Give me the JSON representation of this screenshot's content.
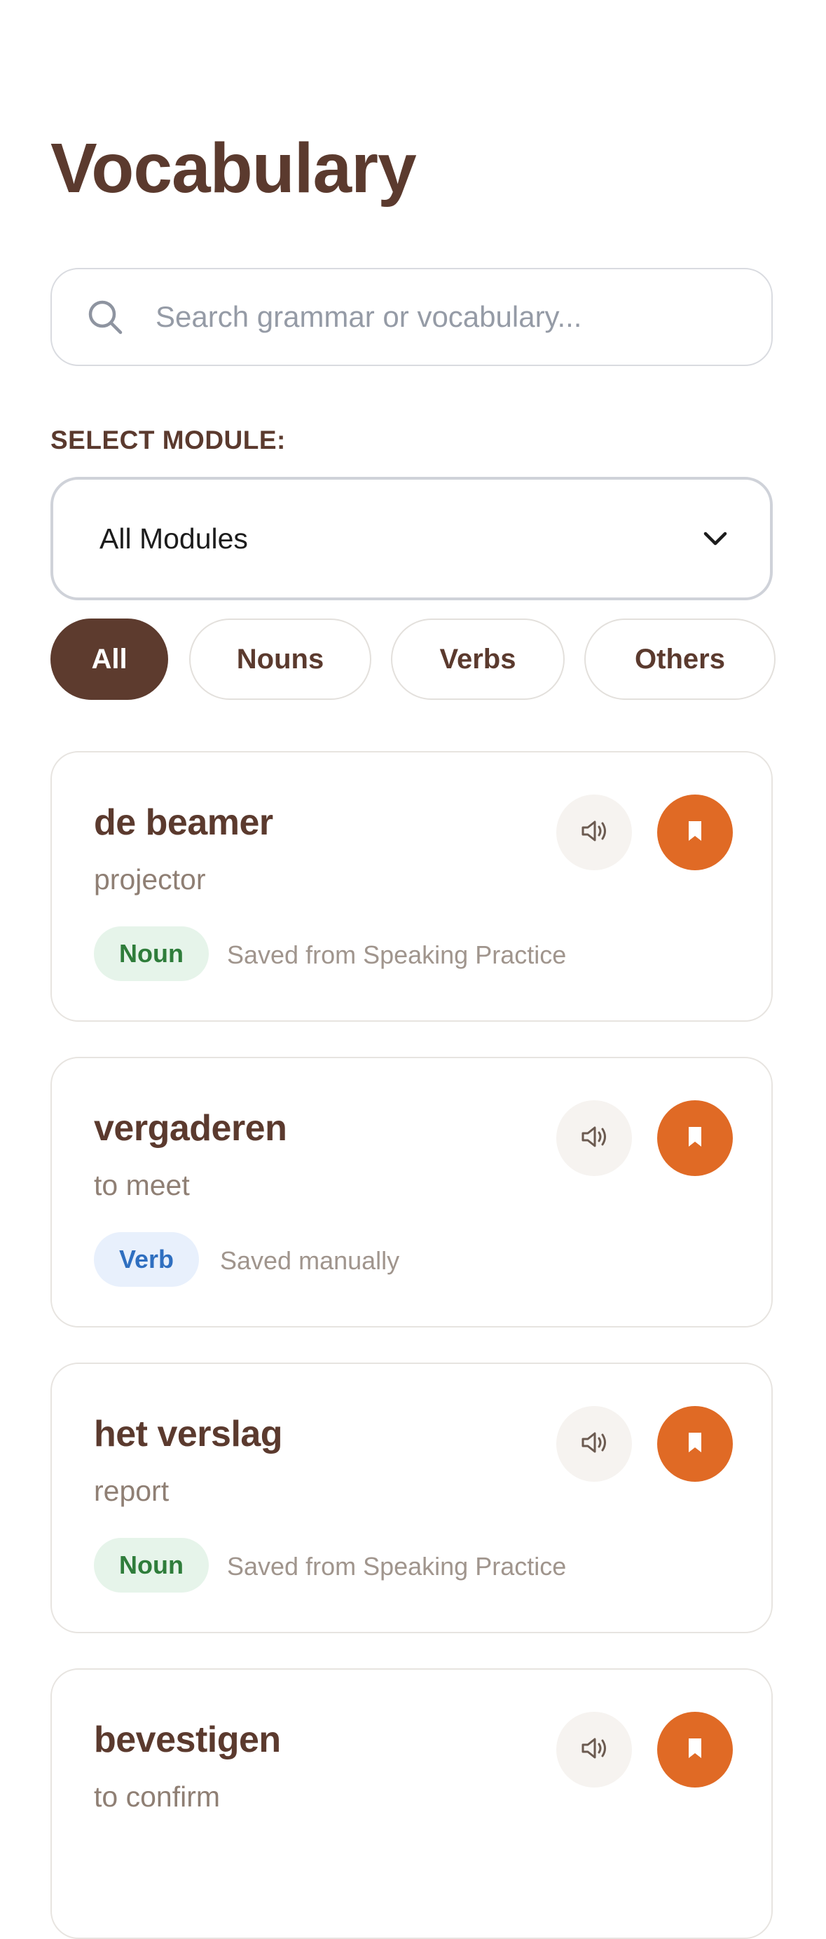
{
  "page": {
    "title": "Vocabulary"
  },
  "search": {
    "placeholder": "Search grammar or vocabulary..."
  },
  "module_select": {
    "label": "SELECT MODULE:",
    "selected": "All Modules"
  },
  "filters": [
    {
      "label": "All",
      "active": true
    },
    {
      "label": "Nouns",
      "active": false
    },
    {
      "label": "Verbs",
      "active": false
    },
    {
      "label": "Others",
      "active": false
    }
  ],
  "cards": [
    {
      "term": "de beamer",
      "translation": "projector",
      "tag": "Noun",
      "source": "Saved from Speaking Practice"
    },
    {
      "term": "vergaderen",
      "translation": "to meet",
      "tag": "Verb",
      "source": "Saved manually"
    },
    {
      "term": "het verslag",
      "translation": "report",
      "tag": "Noun",
      "source": "Saved from Speaking Practice"
    },
    {
      "term": "bevestigen",
      "translation": "to confirm",
      "tag": "",
      "source": ""
    }
  ],
  "colors": {
    "brand_brown": "#5b3a2e",
    "accent_orange": "#e06a25",
    "noun_green": "#2f7d3b",
    "verb_blue": "#2f6fc0"
  },
  "icons": {
    "search": "search-icon",
    "dropdown": "chevron-down-icon",
    "speak": "speaker-icon",
    "save": "bookmark-icon"
  }
}
